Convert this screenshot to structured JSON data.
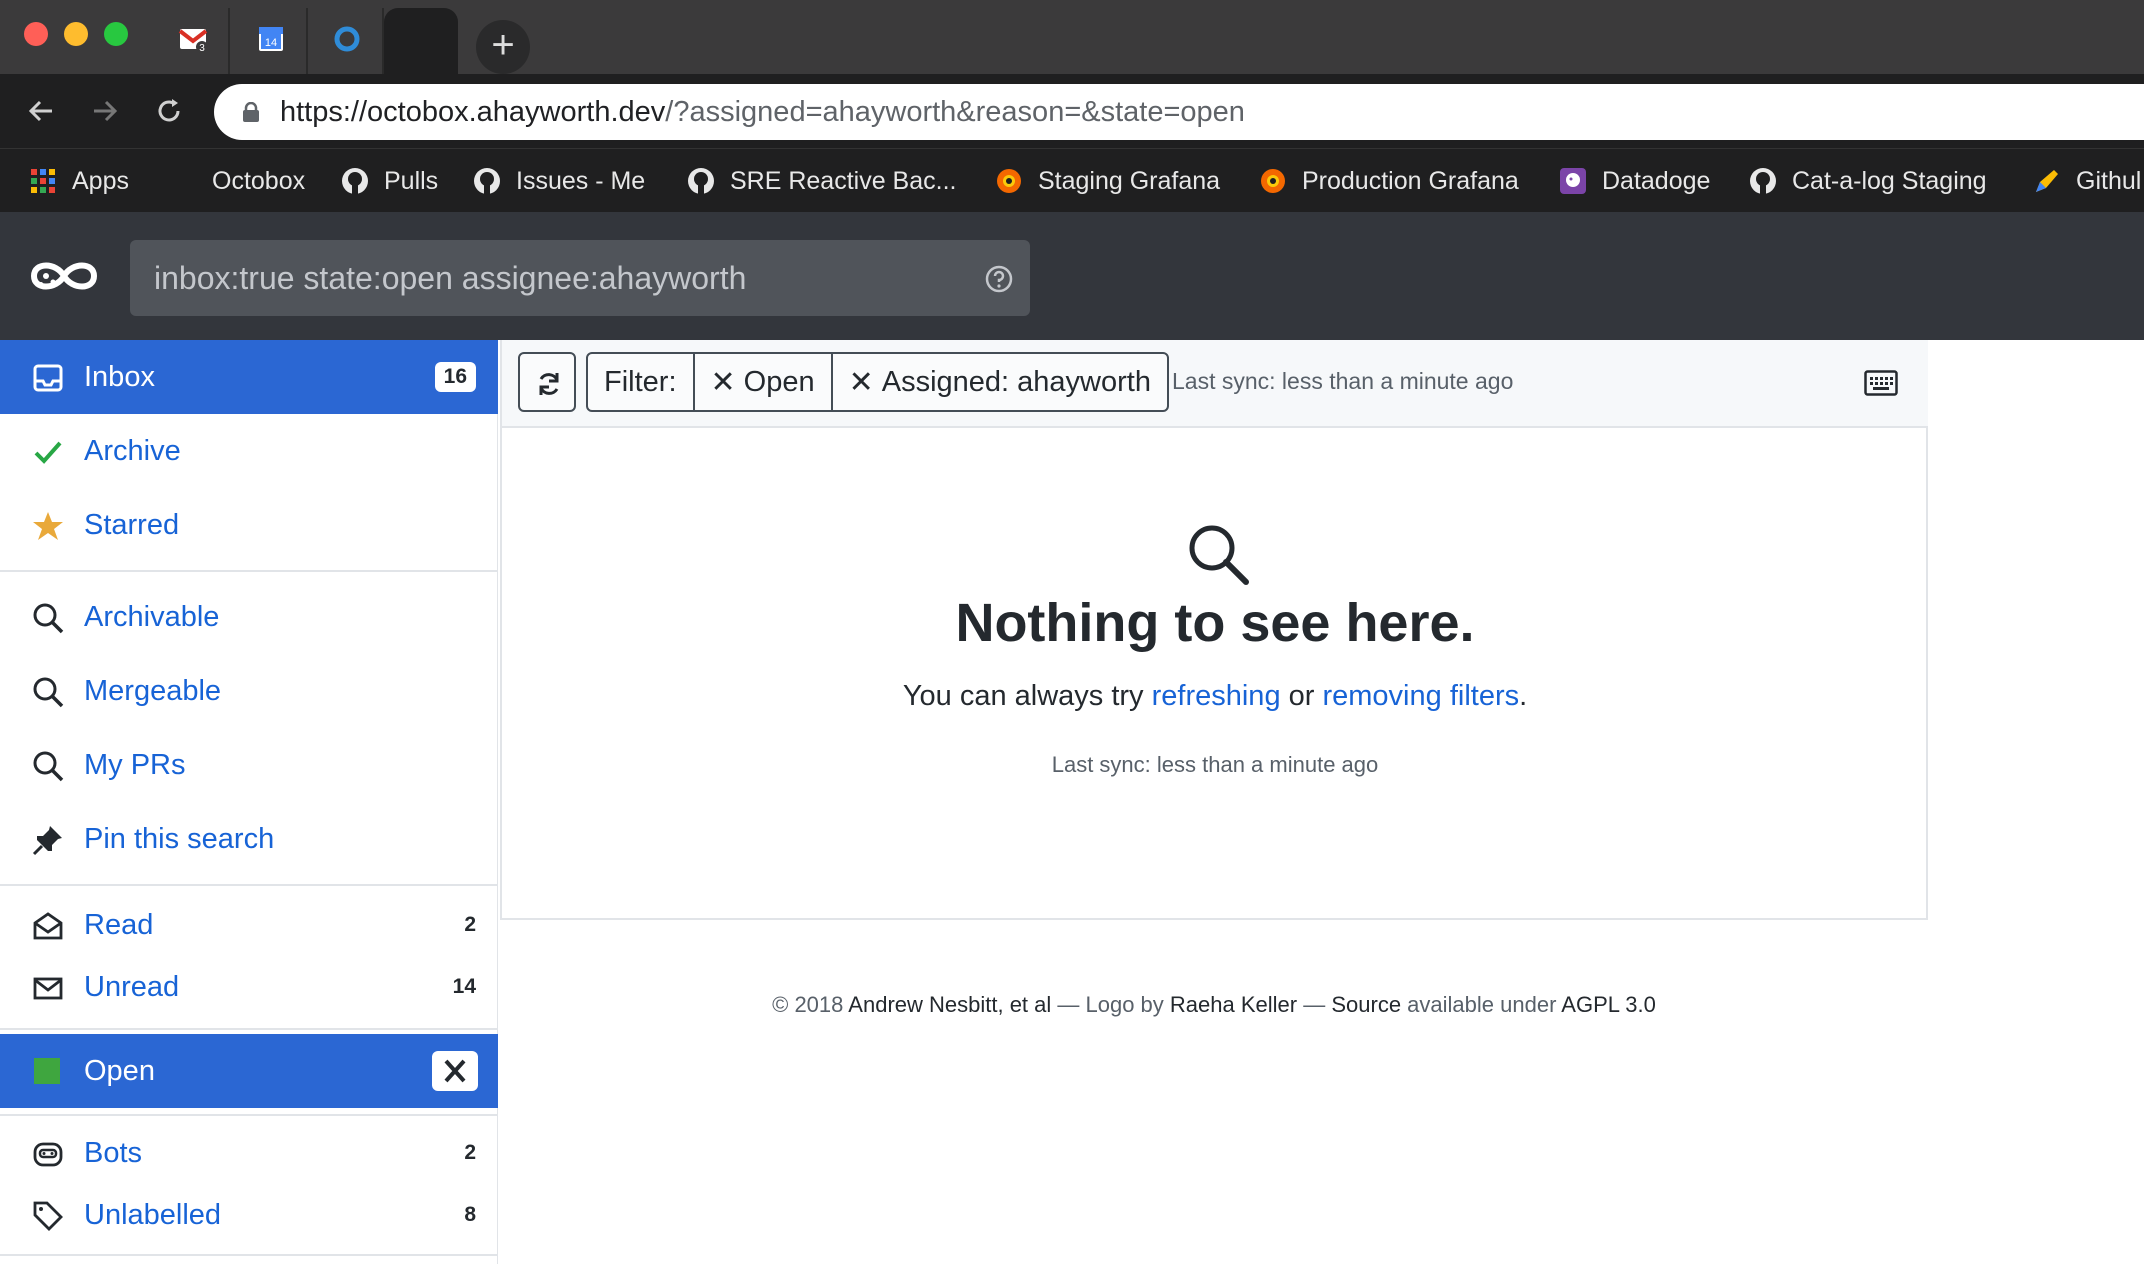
{
  "browser": {
    "url_host": "https://octobox.ahayworth.dev",
    "url_path": "/?assigned=ahayworth&reason=&state=open",
    "calendar_day": "14",
    "gmail_badge": "3",
    "bookmarks": [
      {
        "label": "Apps",
        "icon": "apps-grid-icon"
      },
      {
        "label": "Octobox",
        "icon": "none"
      },
      {
        "label": "Pulls",
        "icon": "github-icon"
      },
      {
        "label": "Issues - Me",
        "icon": "github-icon"
      },
      {
        "label": "SRE Reactive Bac...",
        "icon": "github-icon"
      },
      {
        "label": "Staging Grafana",
        "icon": "grafana-icon"
      },
      {
        "label": "Production Grafana",
        "icon": "grafana-icon"
      },
      {
        "label": "Datadoge",
        "icon": "datadog-icon"
      },
      {
        "label": "Cat-a-log Staging",
        "icon": "github-icon"
      },
      {
        "label": "Githul",
        "icon": "pen-icon"
      }
    ]
  },
  "search": {
    "value": "inbox:true state:open assignee:ahayworth"
  },
  "sidebar": {
    "inbox": {
      "label": "Inbox",
      "count": "16"
    },
    "archive": {
      "label": "Archive"
    },
    "starred": {
      "label": "Starred"
    },
    "archivable": {
      "label": "Archivable"
    },
    "mergeable": {
      "label": "Mergeable"
    },
    "my_prs": {
      "label": "My PRs"
    },
    "pin": {
      "label": "Pin this search"
    },
    "read": {
      "label": "Read",
      "count": "2"
    },
    "unread": {
      "label": "Unread",
      "count": "14"
    },
    "open": {
      "label": "Open"
    },
    "bots": {
      "label": "Bots",
      "count": "2"
    },
    "unlabelled": {
      "label": "Unlabelled",
      "count": "8"
    }
  },
  "toolbar": {
    "filter_label": "Filter:",
    "filter_open": "Open",
    "filter_assigned": "Assigned: ahayworth",
    "last_sync": "Last sync: less than a minute ago"
  },
  "empty_state": {
    "title": "Nothing to see here.",
    "hint_prefix": "You can always try ",
    "refresh_link": "refreshing",
    "hint_middle": " or ",
    "remove_link": "removing filters",
    "hint_suffix": ".",
    "last_sync": "Last sync: less than a minute ago"
  },
  "footer": {
    "copy": "© 2018 ",
    "authors": "Andrew Nesbitt, et al",
    "sep1": " — Logo by ",
    "logo_author": "Raeha Keller",
    "sep2": " — ",
    "source": "Source",
    "avail": " available under ",
    "license": "AGPL 3.0"
  },
  "colors": {
    "accent": "#2b67d3",
    "link": "#1763d6",
    "header": "#33363c",
    "open_state": "#3fa63f",
    "star": "#e9a93a",
    "check": "#28a745"
  }
}
